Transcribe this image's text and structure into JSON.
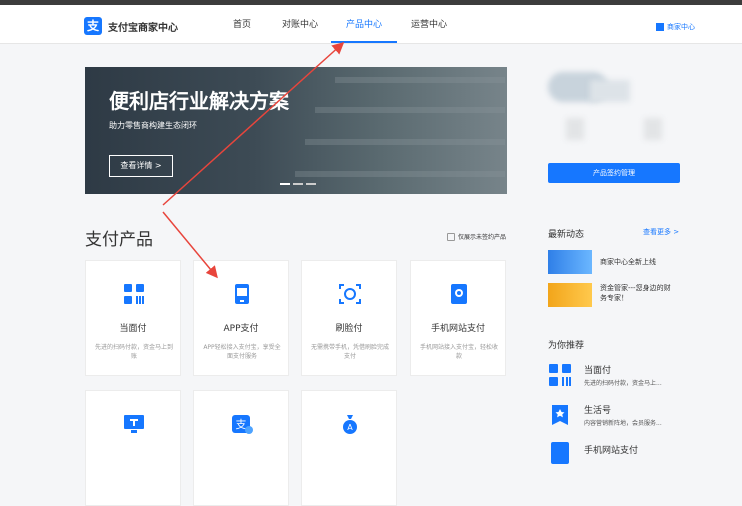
{
  "header": {
    "logo_text": "支付宝商家中心",
    "logo_mark": "支",
    "nav": [
      "首页",
      "对账中心",
      "产品中心",
      "运营中心"
    ],
    "active_nav": "产品中心",
    "merchant_center": "商家中心"
  },
  "banner": {
    "title": "便利店行业解决方案",
    "subtitle": "助力零售商构建生态闭环",
    "button": "查看详情 >"
  },
  "section": {
    "title": "支付产品",
    "filter_label": "仅展示未签约产品"
  },
  "products": [
    {
      "name": "当面付",
      "desc": "先进的扫码付款，资金马上到账",
      "icon": "qrcode-icon"
    },
    {
      "name": "APP支付",
      "desc": "APP轻松接入支付宝，享受全面支付服务",
      "icon": "phone-app-icon"
    },
    {
      "name": "刷脸付",
      "desc": "无需携带手机，凭借刷脸完成支付",
      "icon": "face-scan-icon"
    },
    {
      "name": "手机网站支付",
      "desc": "手机网站接入支付宝，轻松收款",
      "icon": "mobile-site-icon"
    },
    {
      "name": "",
      "desc": "",
      "icon": "monitor-icon"
    },
    {
      "name": "",
      "desc": "",
      "icon": "alipay-badge-icon"
    },
    {
      "name": "",
      "desc": "",
      "icon": "moneybag-icon"
    }
  ],
  "sidebar": {
    "sign_button": "产品签约管理",
    "news_title": "最新动态",
    "news_more": "查看更多 >",
    "news": [
      {
        "text": "商家中心全新上线"
      },
      {
        "text": "资金管家---您身边的财务专家！"
      }
    ],
    "rec_title": "为你推荐",
    "recommendations": [
      {
        "title": "当面付",
        "desc": "先进的扫码付款，资金马上..."
      },
      {
        "title": "生活号",
        "desc": "内容营销新阵地，会员服务..."
      },
      {
        "title": "手机网站支付",
        "desc": ""
      }
    ]
  },
  "colors": {
    "accent": "#1677ff",
    "arrow": "#e8453c"
  }
}
